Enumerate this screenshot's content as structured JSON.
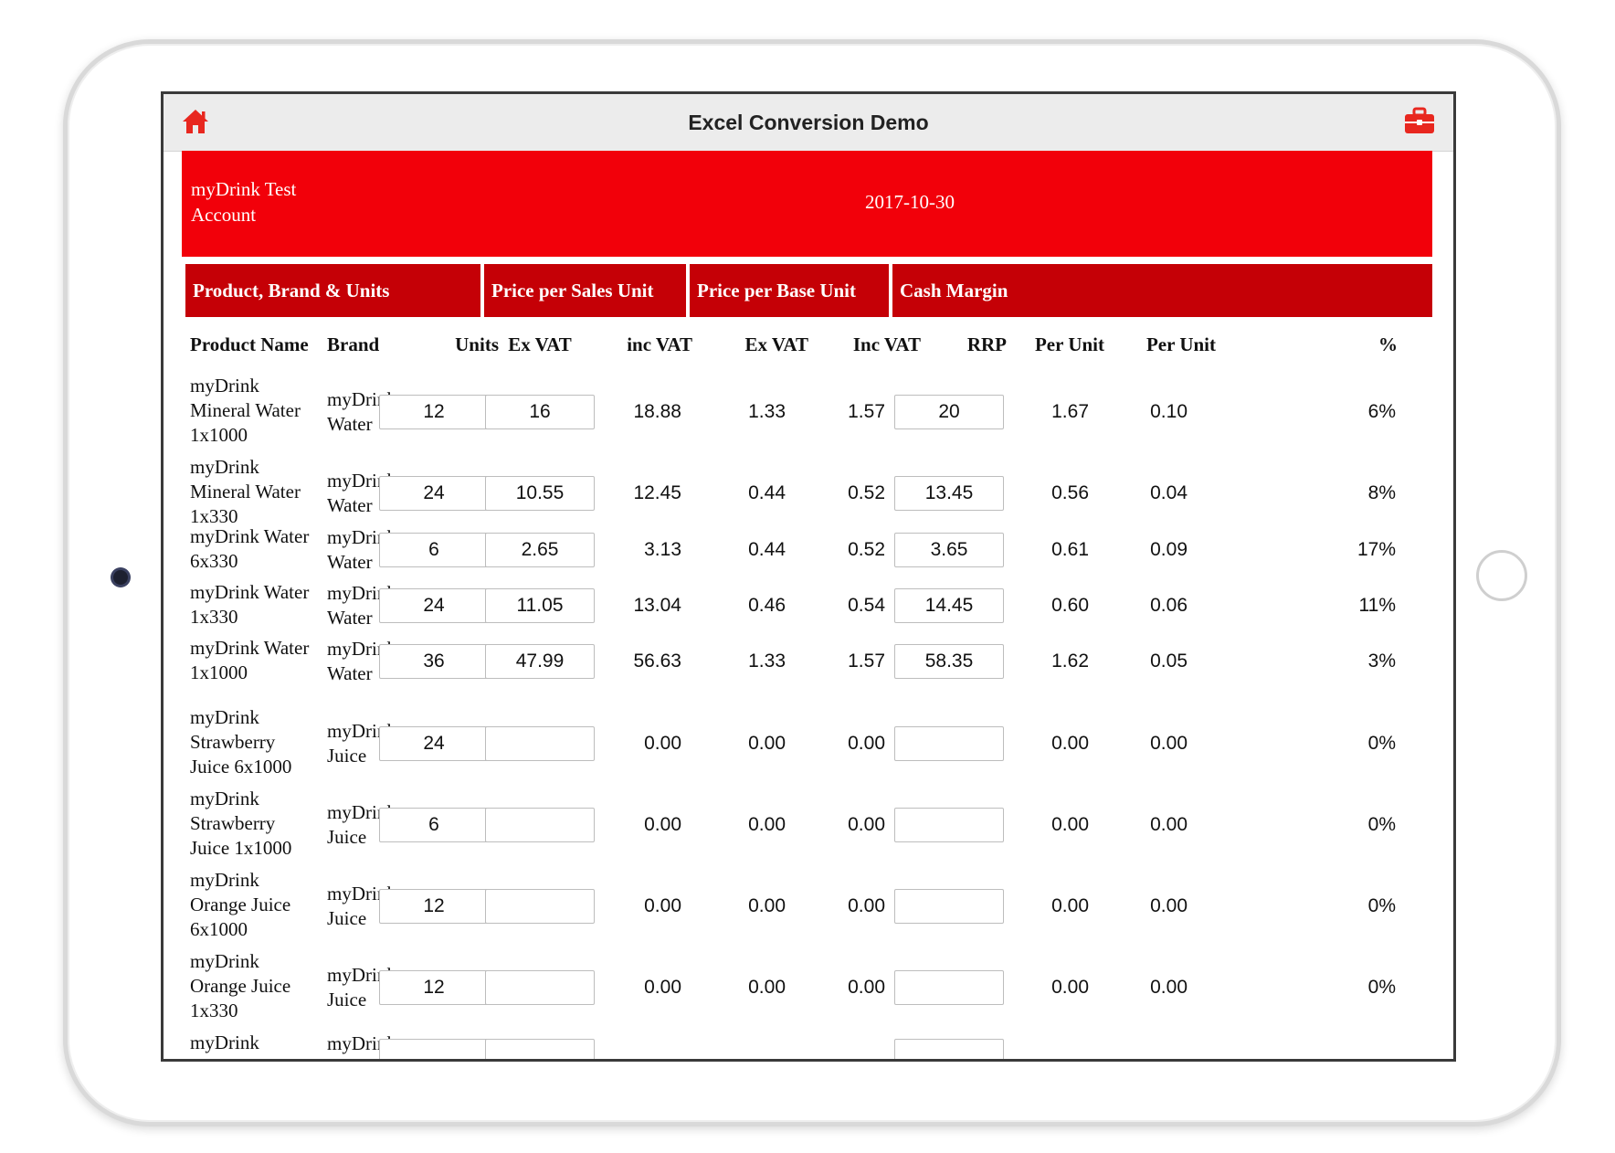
{
  "app": {
    "title": "Excel Conversion Demo",
    "home_icon": "home-icon",
    "toolbox_icon": "toolbox-icon",
    "accent": "#f2000a",
    "group_color": "#c50006"
  },
  "header": {
    "account": "myDrink Test Account",
    "date": "2017-10-30"
  },
  "groups": [
    "Product, Brand & Units",
    "Price per Sales Unit",
    "Price per Base Unit",
    "Cash Margin"
  ],
  "columns": [
    "Product Name",
    "Brand",
    "Units",
    "Ex VAT",
    "inc VAT",
    "Ex VAT",
    "Inc VAT",
    "RRP",
    "Per Unit",
    "Per Unit",
    "%"
  ],
  "rows": [
    {
      "product": "myDrink Mineral Water 1x1000",
      "brand": "myDrink Water",
      "units": "12",
      "exvat": "16",
      "incvat": "18.88",
      "base_ex": "1.33",
      "base_inc": "1.57",
      "rrp": "20",
      "per_unit1": "1.67",
      "per_unit2": "0.10",
      "pct": "6%"
    },
    {
      "product": "myDrink Mineral Water 1x330",
      "brand": "myDrink Water",
      "units": "24",
      "exvat": "10.55",
      "incvat": "12.45",
      "base_ex": "0.44",
      "base_inc": "0.52",
      "rrp": "13.45",
      "per_unit1": "0.56",
      "per_unit2": "0.04",
      "pct": "8%"
    },
    {
      "product": "myDrink Water 6x330",
      "brand": "myDrink Water",
      "units": "6",
      "exvat": "2.65",
      "incvat": "3.13",
      "base_ex": "0.44",
      "base_inc": "0.52",
      "rrp": "3.65",
      "per_unit1": "0.61",
      "per_unit2": "0.09",
      "pct": "17%"
    },
    {
      "product": "myDrink Water 1x330",
      "brand": "myDrink Water",
      "units": "24",
      "exvat": "11.05",
      "incvat": "13.04",
      "base_ex": "0.46",
      "base_inc": "0.54",
      "rrp": "14.45",
      "per_unit1": "0.60",
      "per_unit2": "0.06",
      "pct": "11%"
    },
    {
      "product": "myDrink Water 1x1000",
      "brand": "myDrink Water",
      "units": "36",
      "exvat": "47.99",
      "incvat": "56.63",
      "base_ex": "1.33",
      "base_inc": "1.57",
      "rrp": "58.35",
      "per_unit1": "1.62",
      "per_unit2": "0.05",
      "pct": "3%"
    },
    {
      "product": "myDrink Strawberry Juice 6x1000",
      "brand": "myDrink Juice",
      "units": "24",
      "exvat": "",
      "incvat": "0.00",
      "base_ex": "0.00",
      "base_inc": "0.00",
      "rrp": "",
      "per_unit1": "0.00",
      "per_unit2": "0.00",
      "pct": "0%"
    },
    {
      "product": "myDrink Strawberry Juice 1x1000",
      "brand": "myDrink Juice",
      "units": "6",
      "exvat": "",
      "incvat": "0.00",
      "base_ex": "0.00",
      "base_inc": "0.00",
      "rrp": "",
      "per_unit1": "0.00",
      "per_unit2": "0.00",
      "pct": "0%"
    },
    {
      "product": "myDrink Orange Juice 6x1000",
      "brand": "myDrink Juice",
      "units": "12",
      "exvat": "",
      "incvat": "0.00",
      "base_ex": "0.00",
      "base_inc": "0.00",
      "rrp": "",
      "per_unit1": "0.00",
      "per_unit2": "0.00",
      "pct": "0%"
    },
    {
      "product": "myDrink Orange Juice 1x330",
      "brand": "myDrink Juice",
      "units": "12",
      "exvat": "",
      "incvat": "0.00",
      "base_ex": "0.00",
      "base_inc": "0.00",
      "rrp": "",
      "per_unit1": "0.00",
      "per_unit2": "0.00",
      "pct": "0%"
    },
    {
      "product": "myDrink",
      "brand": "myDrink",
      "units": "",
      "exvat": "",
      "incvat": "",
      "base_ex": "",
      "base_inc": "",
      "rrp": "",
      "per_unit1": "",
      "per_unit2": "",
      "pct": ""
    }
  ]
}
